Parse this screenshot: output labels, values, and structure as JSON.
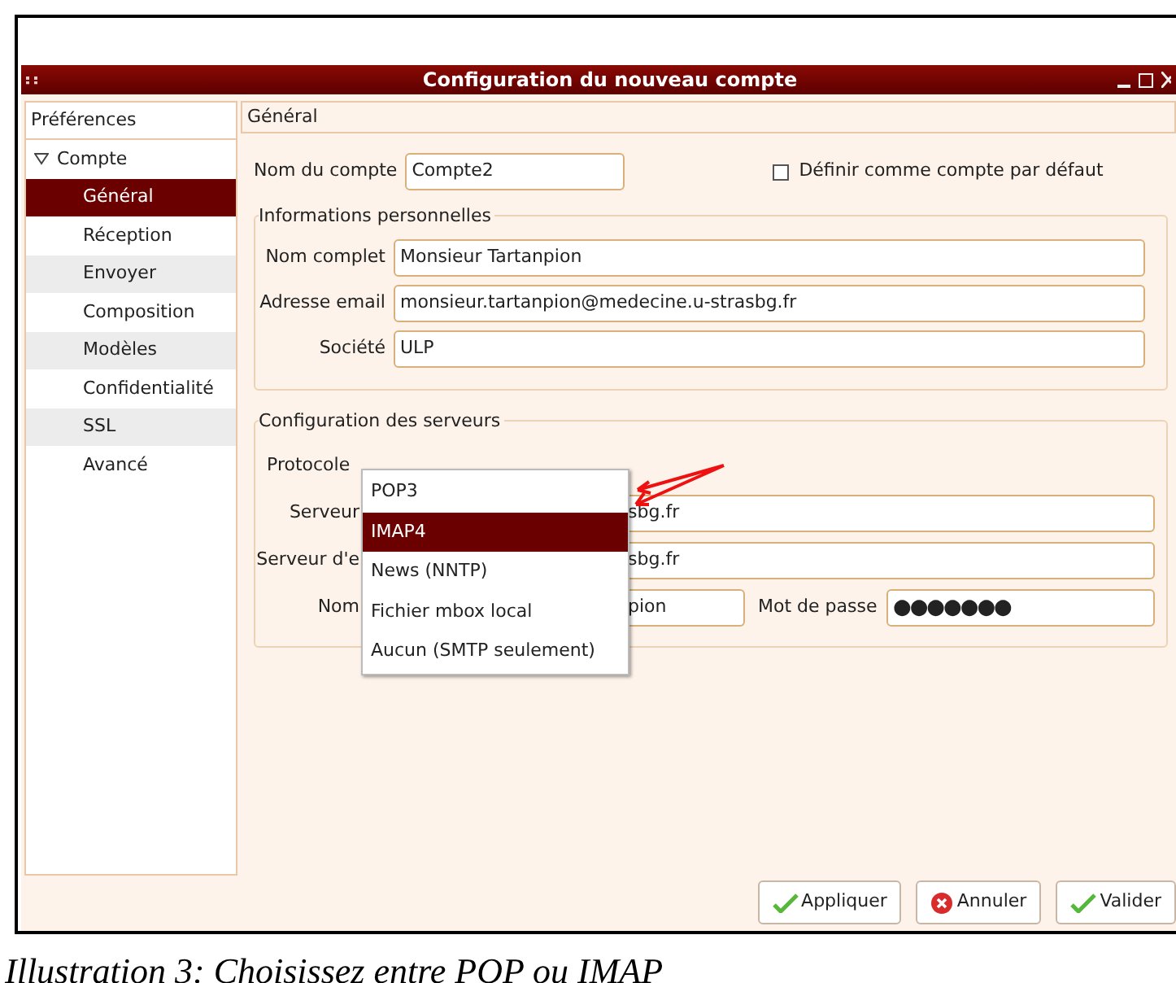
{
  "window": {
    "title": "Configuration du nouveau compte"
  },
  "sidebar": {
    "header": "Préférences",
    "items": [
      {
        "label": "Compte",
        "expanded": true,
        "selected": false,
        "children": [
          {
            "label": "Général",
            "selected": true
          },
          {
            "label": "Réception",
            "selected": false
          },
          {
            "label": "Envoyer",
            "selected": false
          },
          {
            "label": "Composition",
            "selected": false
          },
          {
            "label": "Modèles",
            "selected": false
          },
          {
            "label": "Confidentialité",
            "selected": false
          },
          {
            "label": "SSL",
            "selected": false
          },
          {
            "label": "Avancé",
            "selected": false
          }
        ]
      }
    ]
  },
  "panel": {
    "title": "Général"
  },
  "account_name": {
    "label": "Nom du compte",
    "value": "Compte2"
  },
  "default_checkbox": {
    "label": "Définir comme compte par défaut",
    "checked": false
  },
  "personal": {
    "title": "Informations personnelles",
    "fields": [
      {
        "label": "Nom complet",
        "value": "Monsieur Tartanpion"
      },
      {
        "label": "Adresse email",
        "value": "monsieur.tartanpion@medecine.u-strasbg.fr"
      },
      {
        "label": "Société",
        "value": "ULP"
      }
    ]
  },
  "servers": {
    "title": "Configuration des serveurs",
    "protocol_label": "Protocole",
    "rows": [
      {
        "label": "Serveur",
        "value": "sbg.fr"
      },
      {
        "label": "Serveur d'e",
        "value": "sbg.fr"
      },
      {
        "label": "Nom",
        "value": "pion",
        "password_label": "Mot de passe",
        "password": "●●●●●●●"
      }
    ]
  },
  "dropdown": {
    "options": [
      {
        "label": "POP3",
        "selected": false
      },
      {
        "label": "IMAP4",
        "selected": true
      },
      {
        "label": "News (NNTP)",
        "selected": false
      },
      {
        "label": "Fichier mbox local",
        "selected": false
      },
      {
        "label": "Aucun (SMTP seulement)",
        "selected": false
      }
    ]
  },
  "buttons": [
    {
      "label": "Appliquer",
      "kind": "apply"
    },
    {
      "label": "Annuler",
      "kind": "cancel"
    },
    {
      "label": "Valider",
      "kind": "apply"
    }
  ],
  "caption": "Illustration 3: Choisissez entre POP ou IMAP"
}
